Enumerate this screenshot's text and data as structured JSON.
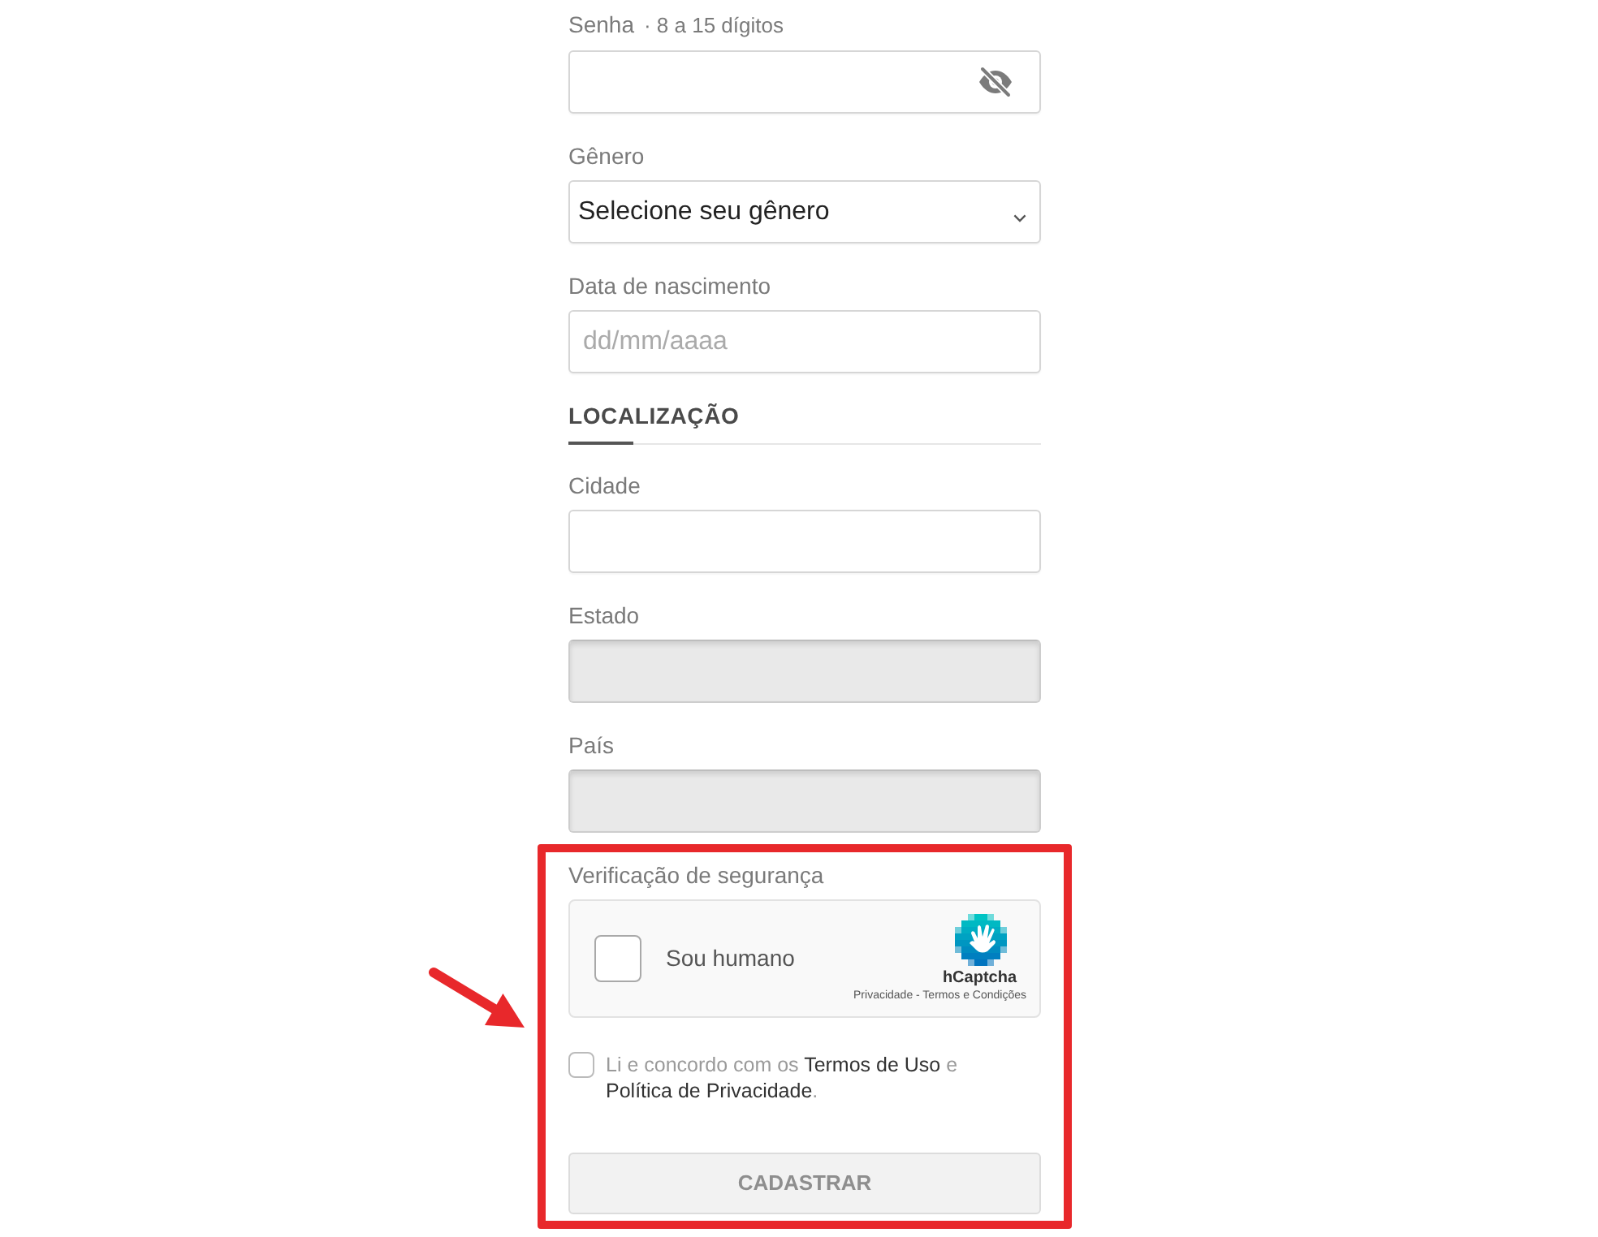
{
  "account_fields": [
    {
      "kind": "password",
      "label": "Senha",
      "requirement": "· 8 a 15 dígitos",
      "disabled": false
    },
    {
      "kind": "select",
      "label": "Gênero",
      "value": "Selecione seu gênero",
      "disabled": false
    },
    {
      "kind": "text",
      "label": "Data de nascimento",
      "placeholder": "dd/mm/aaaa",
      "disabled": false
    }
  ],
  "location": {
    "title": "LOCALIZAÇÃO",
    "fields": [
      {
        "kind": "text",
        "label": "Cidade",
        "disabled": false
      },
      {
        "kind": "text",
        "label": "Estado",
        "disabled": true
      },
      {
        "kind": "text",
        "label": "País",
        "disabled": true
      }
    ]
  },
  "security": {
    "highlighted": true,
    "title": "Verificação de segurança",
    "captcha": {
      "label": "Sou humano",
      "checked": false,
      "brand": "hCaptcha",
      "footer": "Privacidade - Termos e Condições"
    },
    "terms": {
      "checked": false,
      "parts": [
        {
          "kind": "text",
          "text": "Li e concordo com os "
        },
        {
          "kind": "link",
          "text": "Termos de Uso"
        },
        {
          "kind": "text",
          "text": " e "
        },
        {
          "kind": "link",
          "text": "Política de Privacidade"
        },
        {
          "kind": "text",
          "text": "."
        }
      ]
    },
    "submit": {
      "label": "CADASTRAR",
      "disabled": true
    }
  }
}
